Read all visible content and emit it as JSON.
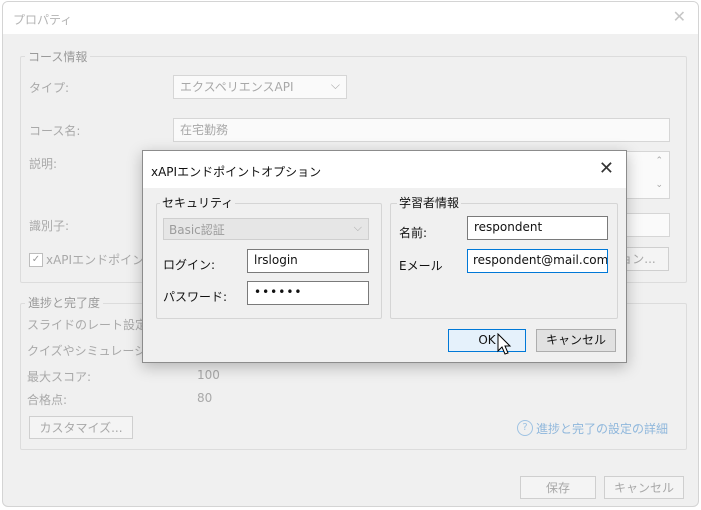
{
  "background_window": {
    "title": "プロパティ",
    "course_info": {
      "group_label": "コース情報",
      "type_label": "タイプ:",
      "type_value": "エクスペリエンスAPI",
      "course_name_label": "コース名:",
      "course_name_value": "在宅勤務",
      "description_label": "説明:",
      "identifier_label": "識別子:",
      "xapi_checkbox_label": "xAPIエンドポイント:",
      "xapi_checked": true,
      "options_button": "ョン..."
    },
    "progress": {
      "group_label": "進捗と完了度",
      "slide_rate_label": "スライドのレート設定:",
      "quiz_label": "クイズやシミュレーション",
      "max_score_label": "最大スコア:",
      "max_score_value": "100",
      "passing_label": "合格点:",
      "passing_value": "80",
      "customize_button": "カスタマイズ...",
      "details_link": "進捗と完了の設定の詳細"
    },
    "footer": {
      "save_button": "保存",
      "cancel_button": "キャンセル"
    }
  },
  "dialog": {
    "title": "xAPIエンドポイントオプション",
    "close_glyph": "✕",
    "security": {
      "group_label": "セキュリティ",
      "auth_select": "Basic認証",
      "login_label": "ログイン:",
      "login_value": "lrslogin",
      "password_label": "パスワード:",
      "password_value": "••••••"
    },
    "learner": {
      "group_label": "学習者情報",
      "name_label": "名前:",
      "name_value": "respondent",
      "email_label": "Eメール",
      "email_value": "respondent@mail.com"
    },
    "ok_button": "OK",
    "cancel_button": "キャンセル"
  }
}
